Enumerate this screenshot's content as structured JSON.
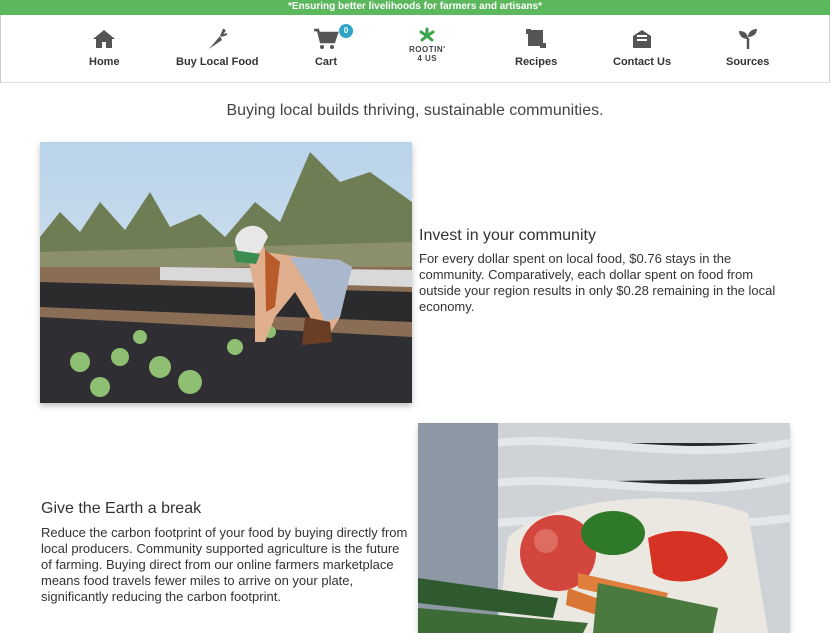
{
  "banner": {
    "text": "*Ensuring better livelihoods for farmers and artisans*"
  },
  "nav": {
    "items": [
      {
        "label": "Home",
        "icon": "home-icon"
      },
      {
        "label": "Buy Local Food",
        "icon": "carrot-icon"
      },
      {
        "label": "Cart",
        "icon": "cart-icon",
        "badge": "0"
      },
      {
        "label": "Recipes",
        "icon": "scroll-icon"
      },
      {
        "label": "Contact Us",
        "icon": "mail-icon"
      },
      {
        "label": "Sources",
        "icon": "sprout-icon"
      }
    ],
    "logo": {
      "line1": "ROOTIN'",
      "line2": "4 US"
    }
  },
  "tagline": "Buying local builds thriving, sustainable communities.",
  "sections": [
    {
      "title": "Invest in your community",
      "body": "For every dollar spent on local food, $0.76 stays in the community. Comparatively, each dollar spent on food from outside your region results in only $0.28 remaining in the local economy."
    },
    {
      "title": "Give the Earth a break",
      "body": "Reduce the carbon footprint of your food by buying directly from local producers. Community supported agriculture is the future of farming. Buying direct from our online farmers marketplace means food travels fewer miles to arrive on your plate, significantly reducing the carbon footprint."
    }
  ],
  "colors": {
    "banner": "#5cb85c",
    "badge": "#2fa4c6",
    "logo_leaf": "#3aa34a"
  }
}
